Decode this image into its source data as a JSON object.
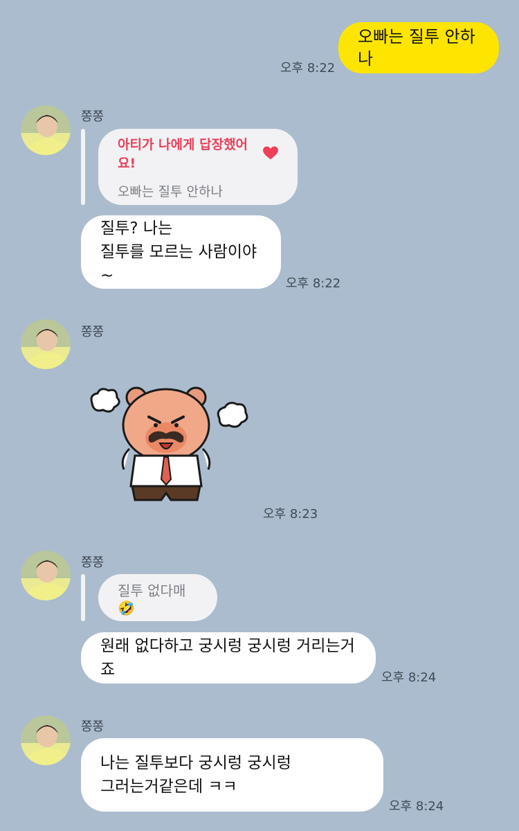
{
  "messages": {
    "m1": {
      "text": "오빠는 질투 안하나",
      "time": "오후 8:22"
    },
    "g1": {
      "name": "쫑쫑",
      "reply_header": "아티가 나에게 답장했어요!",
      "reply_quote": "오빠는 질투 안하나",
      "line1": "질투? 나는",
      "line2": "질투를 모르는 사람이야~",
      "time": "오후 8:22"
    },
    "g2": {
      "name": "쫑쫑",
      "sticker_icon": "angry-bear-sticker",
      "time": "오후 8:23"
    },
    "g3": {
      "name": "쫑쫑",
      "reply_quote": "질투 없다매🤣",
      "text": "원래 없다하고 궁시렁 궁시렁 거리는거죠",
      "time": "오후 8:24"
    },
    "g4": {
      "name": "쫑쫑",
      "line1": "나는 질투보다 궁시렁 궁시렁",
      "line2": "그러는거같은데 ㅋㅋ",
      "time": "오후 8:24"
    }
  },
  "colors": {
    "background": "#abbcce",
    "my_bubble": "#fee500",
    "other_bubble": "#ffffff",
    "reply_header": "#e8415b"
  }
}
